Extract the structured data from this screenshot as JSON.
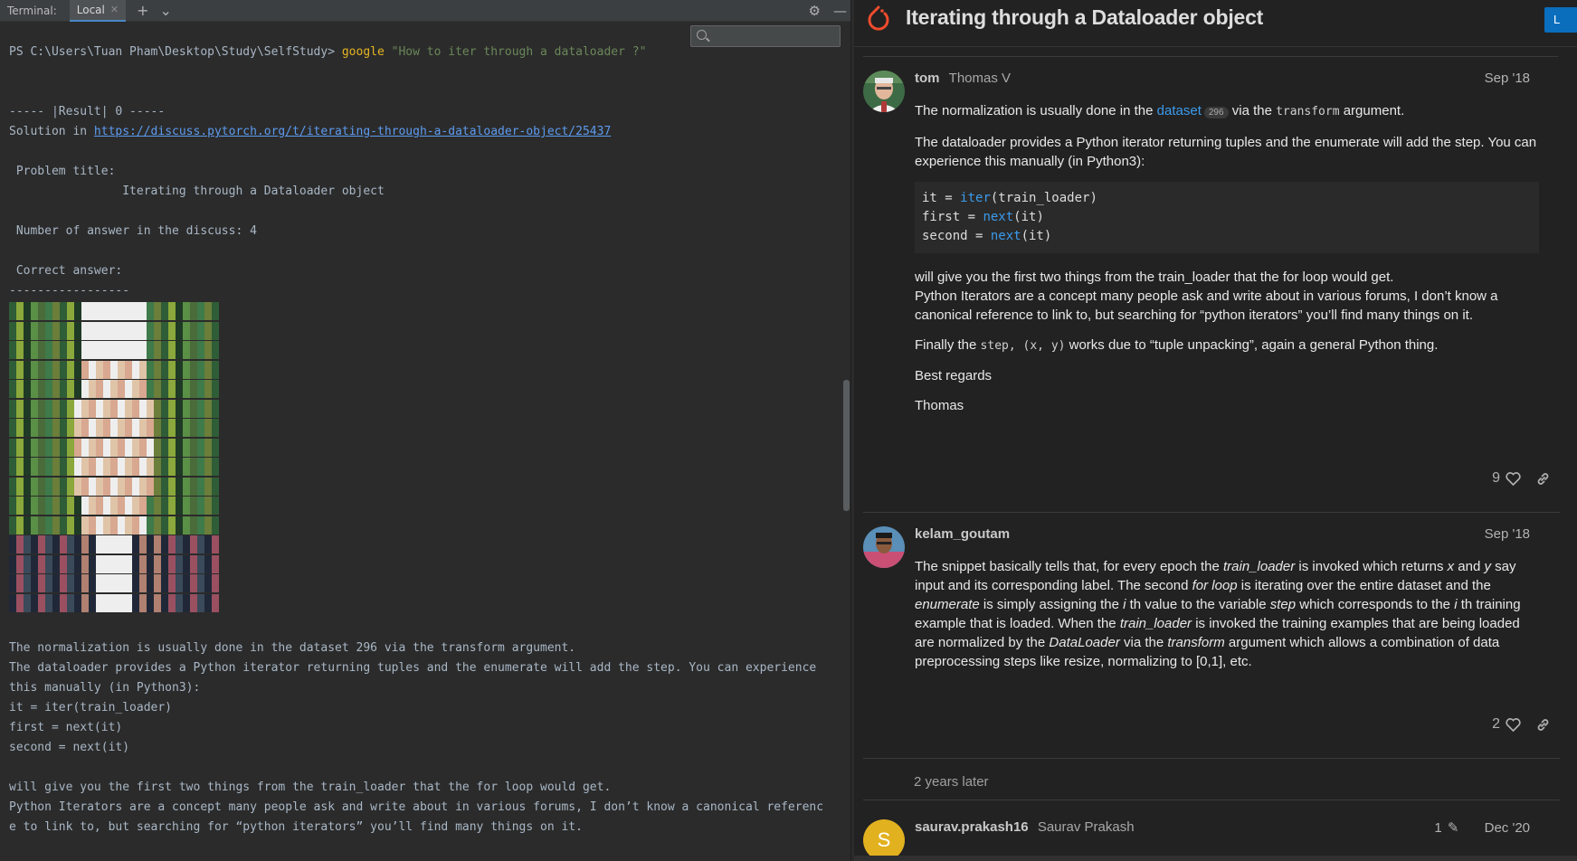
{
  "ide": {
    "panel_title": "Terminal:",
    "tab_label": "Local",
    "terminal_lines": [
      {
        "segments": [
          {
            "t": "PS C:\\Users\\Tuan Pham\\Desktop\\Study\\SelfStudy> ",
            "c": ""
          },
          {
            "t": "google",
            "c": "cmd"
          },
          {
            "t": " \"How to iter through a dataloader ?\"",
            "c": "str"
          }
        ]
      },
      {
        "segments": [
          {
            "t": "",
            "c": ""
          }
        ]
      },
      {
        "segments": [
          {
            "t": "",
            "c": ""
          }
        ]
      },
      {
        "segments": [
          {
            "t": "----- |Result| 0 -----",
            "c": ""
          }
        ]
      },
      {
        "segments": [
          {
            "t": "Solution in ",
            "c": ""
          },
          {
            "t": "https://discuss.pytorch.org/t/iterating-through-a-dataloader-object/25437",
            "c": "link"
          }
        ]
      },
      {
        "segments": [
          {
            "t": "",
            "c": ""
          }
        ]
      },
      {
        "segments": [
          {
            "t": " Problem title:",
            "c": ""
          }
        ]
      },
      {
        "segments": [
          {
            "t": "                Iterating through a Dataloader object",
            "c": ""
          }
        ]
      },
      {
        "segments": [
          {
            "t": "",
            "c": ""
          }
        ]
      },
      {
        "segments": [
          {
            "t": " Number of answer in the discuss: 4",
            "c": ""
          }
        ]
      },
      {
        "segments": [
          {
            "t": "",
            "c": ""
          }
        ]
      },
      {
        "segments": [
          {
            "t": " Correct answer:",
            "c": ""
          }
        ]
      },
      {
        "segments": [
          {
            "t": "-----------------",
            "c": ""
          }
        ]
      }
    ],
    "terminal_tail": [
      "The normalization is usually done in the dataset 296 via the transform argument.",
      "The dataloader provides a Python iterator returning tuples and the enumerate will add the step. You can experience",
      "this manually (in Python3):",
      "it = iter(train_loader)",
      "first = next(it)",
      "second = next(it)",
      "",
      "will give you the first two things from the train_loader that the for loop would get.",
      "Python Iterators are a concept many people ask and write about in various forums, I don’t know a canonical referenc",
      "e to link to, but searching for “python iterators” you’ll find many things on it."
    ]
  },
  "forum": {
    "title": "Iterating through a Dataloader object",
    "login_label": "L",
    "posts": [
      {
        "username": "tom",
        "fullname": "Thomas V",
        "date": "Sep '18",
        "p1_pre": "The normalization is usually done in the ",
        "p1_link": "dataset",
        "p1_badge": "296",
        "p1_mid": " via the ",
        "p1_code": "transform",
        "p1_post": " argument.",
        "p2": "The dataloader provides a Python iterator returning tuples and the enumerate will add the step. You can experience this manually (in Python3):",
        "code_l1_a": "it = ",
        "code_l1_fn": "iter",
        "code_l1_b": "(train_loader)",
        "code_l2_a": "first = ",
        "code_l2_fn": "next",
        "code_l2_b": "(it)",
        "code_l3_a": "second = ",
        "code_l3_fn": "next",
        "code_l3_b": "(it)",
        "p3a": "will give you the first two things from the train_loader that the for loop would get.",
        "p3b": "Python Iterators are a concept many people ask and write about in various forums, I don’t know a canonical reference to link to, but searching for “python iterators” you’ll find many things on it.",
        "p4_pre": "Finally the ",
        "p4_code": "step, (x, y)",
        "p4_post": " works due to “tuple unpacking”, again a general Python thing.",
        "p5": "Best regards",
        "p6": "Thomas",
        "likes": "9"
      },
      {
        "username": "kelam_goutam",
        "date": "Sep '18",
        "b1": "The snippet basically tells that, for every epoch the ",
        "b1i": "train_loader",
        "b2": " is invoked which returns ",
        "b2i": "x",
        "b3": " and ",
        "b3i": "y",
        "b4": " say input and its corresponding label. The second ",
        "b4i": "for loop",
        "b5": " is iterating over the entire dataset and the ",
        "b5i": "enumerate",
        "b6": " is simply assigning the ",
        "b6i": "i",
        "b7": " th value to the variable ",
        "b7i": "step",
        "b8": " which corresponds to the ",
        "b8i": "i",
        "b9": " th training example that is loaded. When the ",
        "b9i": "train_loader",
        "b10": " is invoked the training examples that are being loaded are normalized by the ",
        "b10i": "DataLoader",
        "b11": " via the ",
        "b11i": "transform",
        "b12": " argument which allows a combination of data preprocessing steps like resize, normalizing to [0,1], etc.",
        "likes": "2"
      },
      {
        "username": "saurav.prakash16",
        "fullname": "Saurav Prakash",
        "date": "Dec '20",
        "edits": "1",
        "avatar_letter": "S"
      }
    ],
    "time_gap": "2 years later"
  }
}
